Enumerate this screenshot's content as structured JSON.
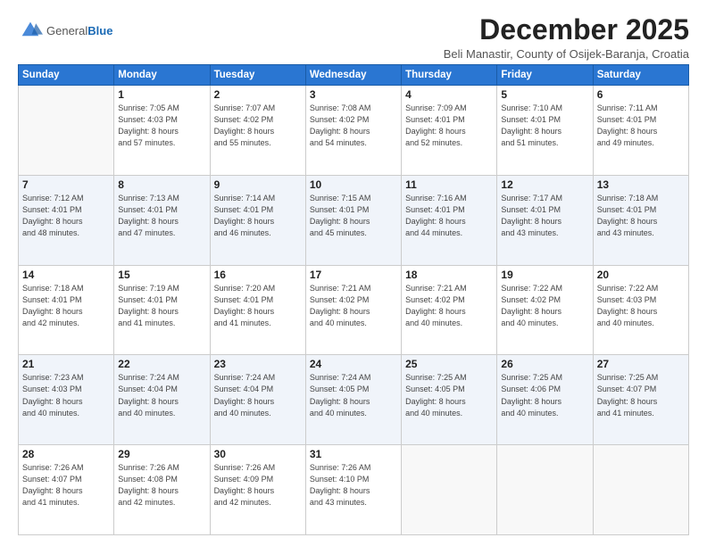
{
  "header": {
    "logo_general": "General",
    "logo_blue": "Blue",
    "month_title": "December 2025",
    "subtitle": "Beli Manastir, County of Osijek-Baranja, Croatia"
  },
  "weekdays": [
    "Sunday",
    "Monday",
    "Tuesday",
    "Wednesday",
    "Thursday",
    "Friday",
    "Saturday"
  ],
  "rows": [
    [
      {
        "day": "",
        "detail": ""
      },
      {
        "day": "1",
        "detail": "Sunrise: 7:05 AM\nSunset: 4:03 PM\nDaylight: 8 hours\nand 57 minutes."
      },
      {
        "day": "2",
        "detail": "Sunrise: 7:07 AM\nSunset: 4:02 PM\nDaylight: 8 hours\nand 55 minutes."
      },
      {
        "day": "3",
        "detail": "Sunrise: 7:08 AM\nSunset: 4:02 PM\nDaylight: 8 hours\nand 54 minutes."
      },
      {
        "day": "4",
        "detail": "Sunrise: 7:09 AM\nSunset: 4:01 PM\nDaylight: 8 hours\nand 52 minutes."
      },
      {
        "day": "5",
        "detail": "Sunrise: 7:10 AM\nSunset: 4:01 PM\nDaylight: 8 hours\nand 51 minutes."
      },
      {
        "day": "6",
        "detail": "Sunrise: 7:11 AM\nSunset: 4:01 PM\nDaylight: 8 hours\nand 49 minutes."
      }
    ],
    [
      {
        "day": "7",
        "detail": "Sunrise: 7:12 AM\nSunset: 4:01 PM\nDaylight: 8 hours\nand 48 minutes."
      },
      {
        "day": "8",
        "detail": "Sunrise: 7:13 AM\nSunset: 4:01 PM\nDaylight: 8 hours\nand 47 minutes."
      },
      {
        "day": "9",
        "detail": "Sunrise: 7:14 AM\nSunset: 4:01 PM\nDaylight: 8 hours\nand 46 minutes."
      },
      {
        "day": "10",
        "detail": "Sunrise: 7:15 AM\nSunset: 4:01 PM\nDaylight: 8 hours\nand 45 minutes."
      },
      {
        "day": "11",
        "detail": "Sunrise: 7:16 AM\nSunset: 4:01 PM\nDaylight: 8 hours\nand 44 minutes."
      },
      {
        "day": "12",
        "detail": "Sunrise: 7:17 AM\nSunset: 4:01 PM\nDaylight: 8 hours\nand 43 minutes."
      },
      {
        "day": "13",
        "detail": "Sunrise: 7:18 AM\nSunset: 4:01 PM\nDaylight: 8 hours\nand 43 minutes."
      }
    ],
    [
      {
        "day": "14",
        "detail": "Sunrise: 7:18 AM\nSunset: 4:01 PM\nDaylight: 8 hours\nand 42 minutes."
      },
      {
        "day": "15",
        "detail": "Sunrise: 7:19 AM\nSunset: 4:01 PM\nDaylight: 8 hours\nand 41 minutes."
      },
      {
        "day": "16",
        "detail": "Sunrise: 7:20 AM\nSunset: 4:01 PM\nDaylight: 8 hours\nand 41 minutes."
      },
      {
        "day": "17",
        "detail": "Sunrise: 7:21 AM\nSunset: 4:02 PM\nDaylight: 8 hours\nand 40 minutes."
      },
      {
        "day": "18",
        "detail": "Sunrise: 7:21 AM\nSunset: 4:02 PM\nDaylight: 8 hours\nand 40 minutes."
      },
      {
        "day": "19",
        "detail": "Sunrise: 7:22 AM\nSunset: 4:02 PM\nDaylight: 8 hours\nand 40 minutes."
      },
      {
        "day": "20",
        "detail": "Sunrise: 7:22 AM\nSunset: 4:03 PM\nDaylight: 8 hours\nand 40 minutes."
      }
    ],
    [
      {
        "day": "21",
        "detail": "Sunrise: 7:23 AM\nSunset: 4:03 PM\nDaylight: 8 hours\nand 40 minutes."
      },
      {
        "day": "22",
        "detail": "Sunrise: 7:24 AM\nSunset: 4:04 PM\nDaylight: 8 hours\nand 40 minutes."
      },
      {
        "day": "23",
        "detail": "Sunrise: 7:24 AM\nSunset: 4:04 PM\nDaylight: 8 hours\nand 40 minutes."
      },
      {
        "day": "24",
        "detail": "Sunrise: 7:24 AM\nSunset: 4:05 PM\nDaylight: 8 hours\nand 40 minutes."
      },
      {
        "day": "25",
        "detail": "Sunrise: 7:25 AM\nSunset: 4:05 PM\nDaylight: 8 hours\nand 40 minutes."
      },
      {
        "day": "26",
        "detail": "Sunrise: 7:25 AM\nSunset: 4:06 PM\nDaylight: 8 hours\nand 40 minutes."
      },
      {
        "day": "27",
        "detail": "Sunrise: 7:25 AM\nSunset: 4:07 PM\nDaylight: 8 hours\nand 41 minutes."
      }
    ],
    [
      {
        "day": "28",
        "detail": "Sunrise: 7:26 AM\nSunset: 4:07 PM\nDaylight: 8 hours\nand 41 minutes."
      },
      {
        "day": "29",
        "detail": "Sunrise: 7:26 AM\nSunset: 4:08 PM\nDaylight: 8 hours\nand 42 minutes."
      },
      {
        "day": "30",
        "detail": "Sunrise: 7:26 AM\nSunset: 4:09 PM\nDaylight: 8 hours\nand 42 minutes."
      },
      {
        "day": "31",
        "detail": "Sunrise: 7:26 AM\nSunset: 4:10 PM\nDaylight: 8 hours\nand 43 minutes."
      },
      {
        "day": "",
        "detail": ""
      },
      {
        "day": "",
        "detail": ""
      },
      {
        "day": "",
        "detail": ""
      }
    ]
  ]
}
